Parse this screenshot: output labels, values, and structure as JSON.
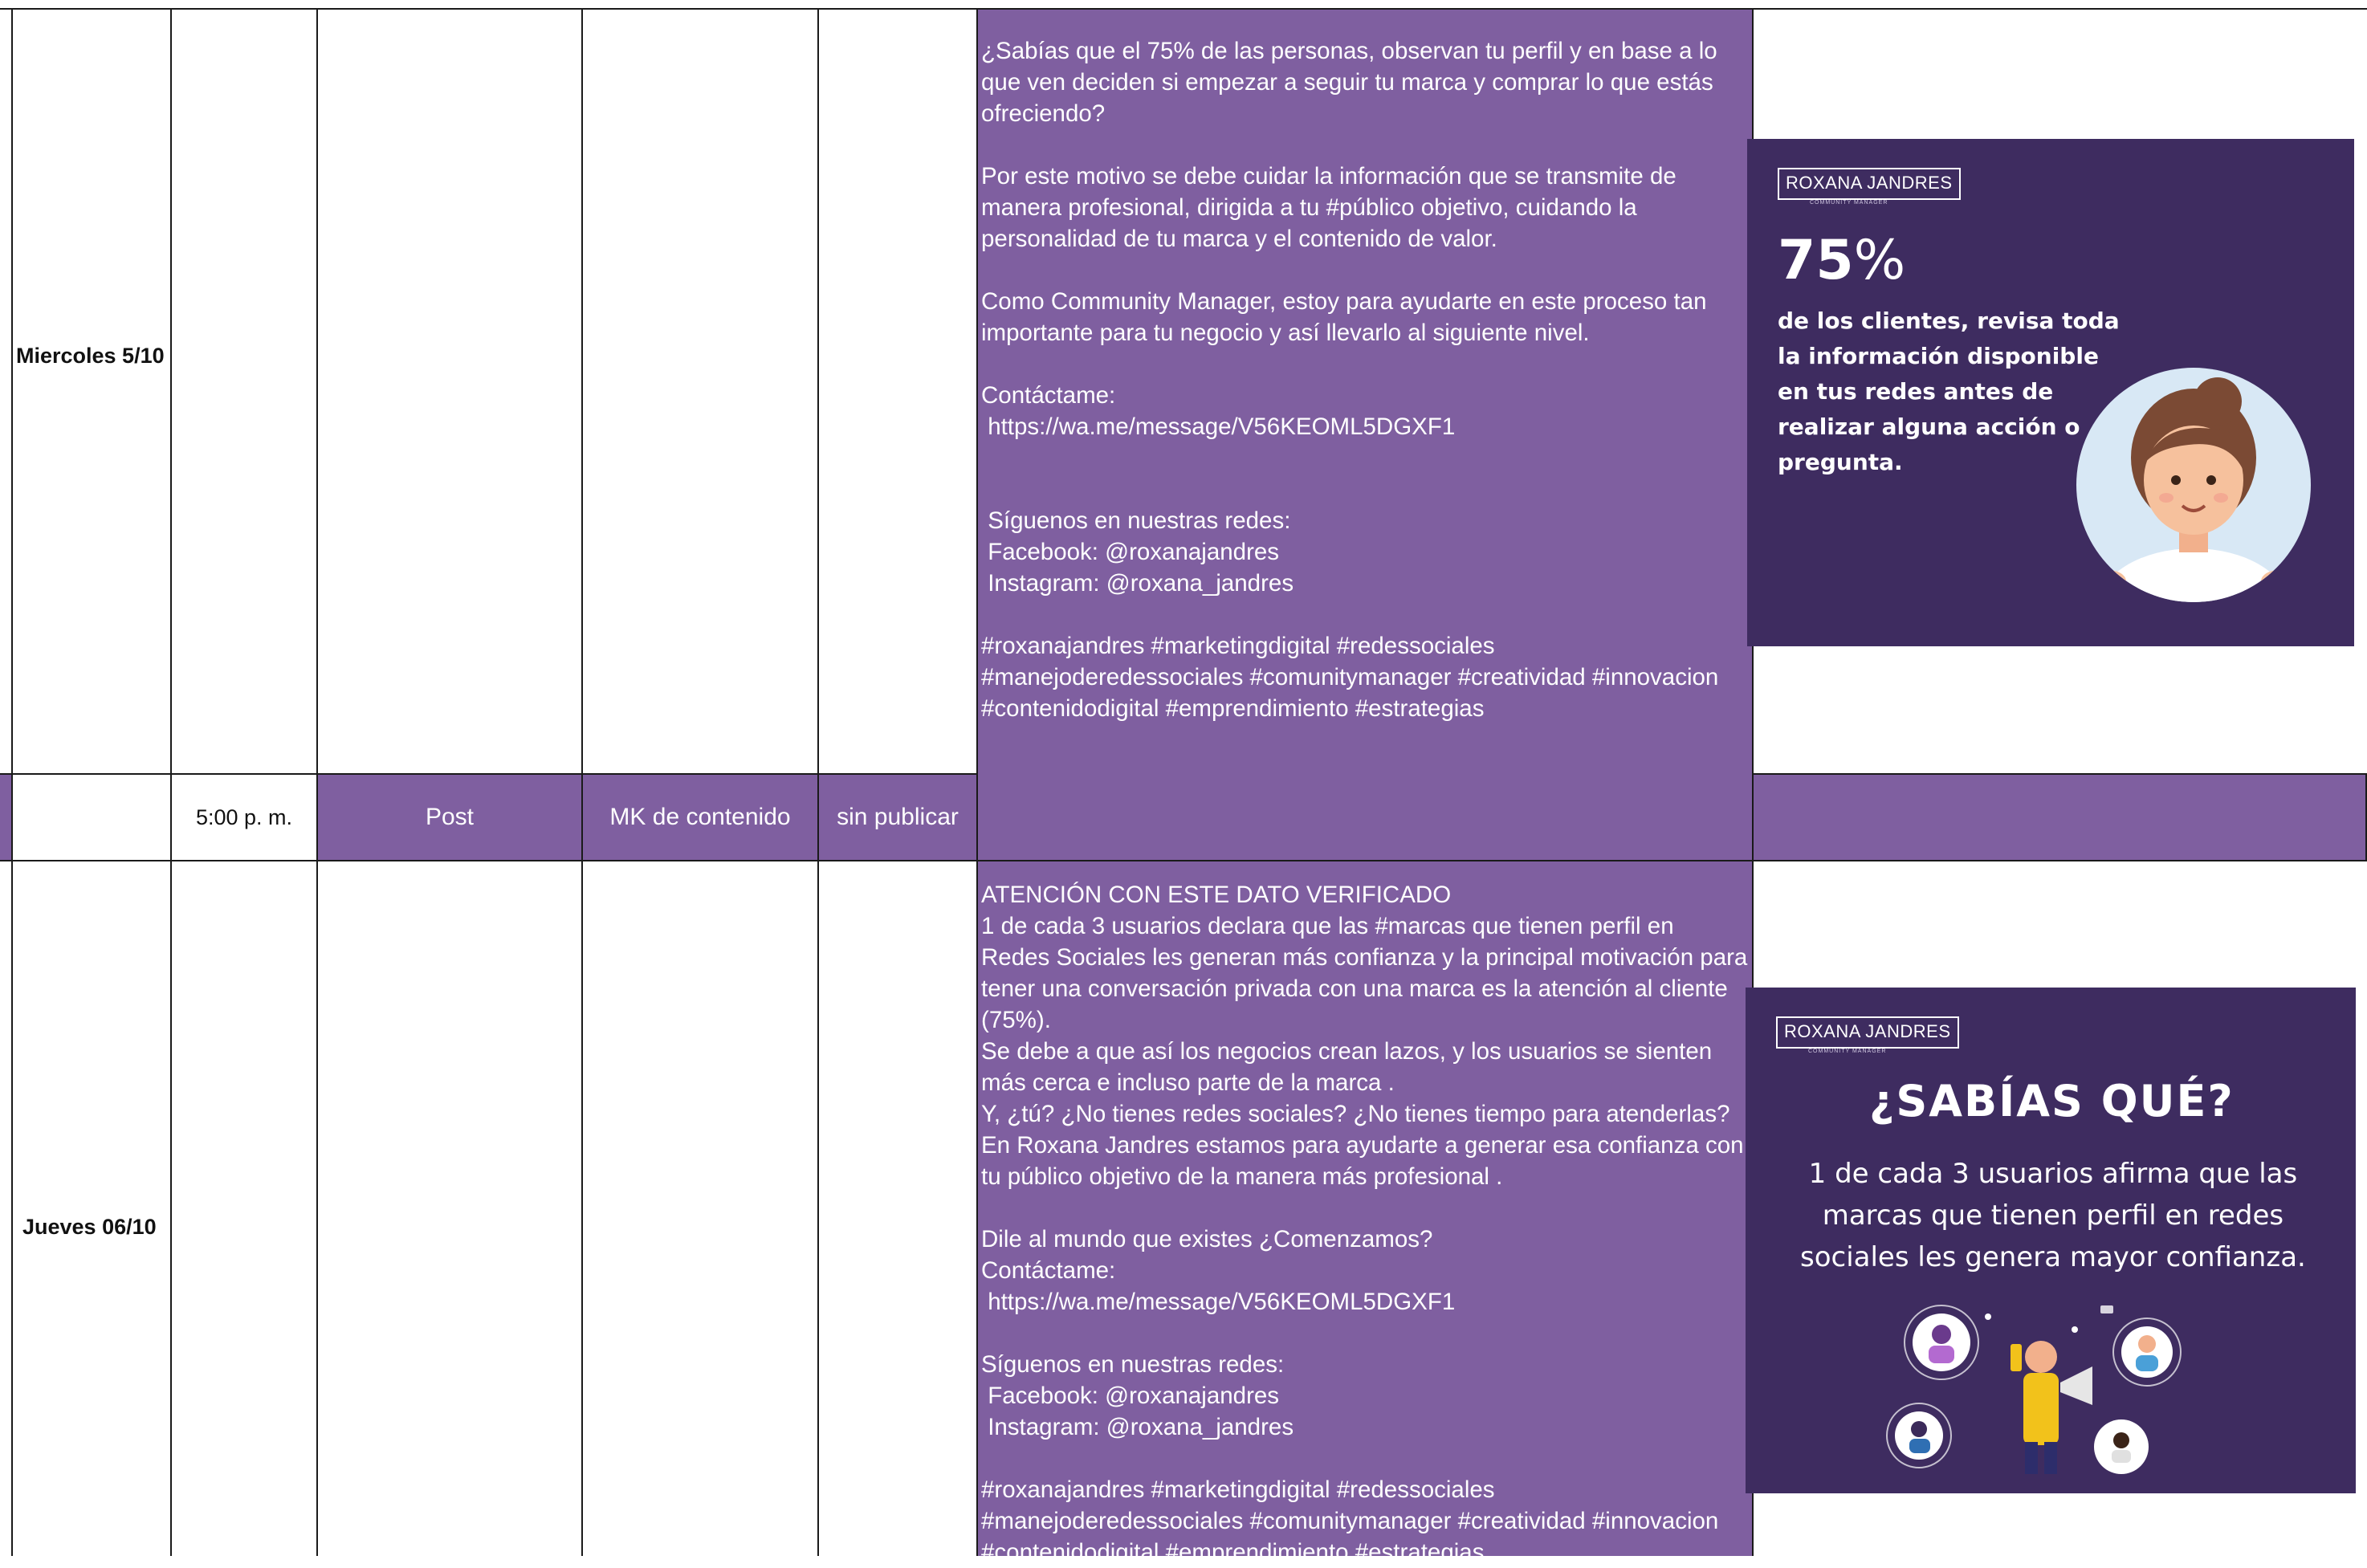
{
  "rows": [
    {
      "day": "Miercoles 5/10",
      "copy": "¿Sabías que el 75% de las personas, observan tu perfil y en base a lo que ven deciden si empezar a seguir tu marca y comprar lo que estás ofreciendo?\n\nPor este motivo se debe cuidar la información que se transmite de manera profesional, dirigida a tu #público objetivo, cuidando la personalidad de tu marca y el contenido de valor.\n\nComo Community Manager, estoy para ayudarte en este proceso tan importante para tu negocio y así llevarlo al siguiente nivel.\n\nContáctame:\n https://wa.me/message/V56KEOML5DGXF1\n\n\n Síguenos en nuestras redes:\n Facebook: @roxanajandres\n Instagram: @roxana_jandres\n\n#roxanajandres #marketingdigital #redessociales #manejoderedessociales #comunitymanager #creatividad #innovacion #contenidodigital #emprendimiento #estrategias",
      "image": {
        "brand": "ROXANA JANDRES",
        "brand_sub": "COMMUNITY MANAGER",
        "stat_number": "75",
        "stat_symbol": "%",
        "stat_text": "de los clientes, revisa toda\nla información disponible\nen tus redes antes de\nrealizar alguna acción o\npregunta."
      }
    },
    {
      "time": "5:00 p. m.",
      "type": "Post",
      "category": "MK de contenido",
      "status": "sin publicar",
      "day": "Jueves 06/10",
      "copy": "ATENCIÓN CON ESTE DATO VERIFICADO\n1 de cada 3 usuarios declara que las #marcas que tienen perfil en Redes Sociales les generan más confianza y la principal motivación para tener una conversación privada con una marca es la atención al cliente (75%).\nSe debe a que así los negocios crean lazos, y los usuarios se sienten más cerca e incluso parte de la marca .\nY, ¿tú? ¿No tienes redes sociales? ¿No tienes tiempo para atenderlas? En Roxana Jandres estamos para ayudarte a generar esa confianza con tu público objetivo de la manera más profesional .\n\nDile al mundo que existes ¿Comenzamos?\nContáctame:\n https://wa.me/message/V56KEOML5DGXF1\n\nSíguenos en nuestras redes:\n Facebook: @roxanajandres\n Instagram: @roxana_jandres\n\n#roxanajandres #marketingdigital #redessociales #manejoderedessociales #comunitymanager #creatividad #innovacion #contenidodigital #emprendimiento #estrategias",
      "image": {
        "brand": "ROXANA JANDRES",
        "brand_sub": "COMMUNITY MANAGER",
        "headline": "¿SABÍAS QUÉ?",
        "text": "1 de cada 3 usuarios afirma que las\nmarcas que tienen perfil en redes\nsociales les genera mayor confianza."
      }
    }
  ],
  "colors": {
    "row_purple": "#7f5fa0",
    "promo_bg": "#3e2c60",
    "grid": "#1a1a1a"
  }
}
